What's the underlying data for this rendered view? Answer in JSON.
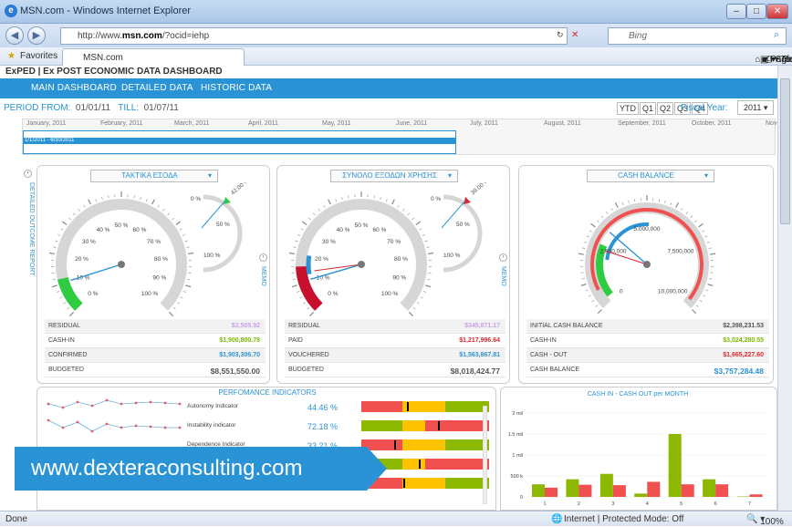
{
  "browser": {
    "window_title": "MSN.com - Windows Internet Explorer",
    "url_prefix": "http://www.",
    "url_domain": "msn.com",
    "url_suffix": "/?ocid=iehp",
    "search_placeholder": "Bing",
    "favorites_label": "Favorites",
    "tab_label": "MSN.com",
    "cmd_page": "Page ▾",
    "cmd_safety": "Safety ▾",
    "cmd_tools": "Tools ▾",
    "status_left": "Done",
    "status_zone": "Internet | Protected Mode: Off",
    "zoom": "100%"
  },
  "app": {
    "title": "ExPED | Ex POST ECONOMIC DATA DASHBOARD",
    "nav": [
      "MAIN DASHBOARD",
      "DETAILED DATA",
      "HISTORIC DATA"
    ],
    "period_label": "PERIOD FROM:",
    "period_from": "01/01/11",
    "period_till_label": "TILL:",
    "period_till": "01/07/11",
    "period_buttons": [
      "YTD",
      "Q1",
      "Q2",
      "Q3",
      "Q4"
    ],
    "fiscal_year_label": "Fiscal Year:",
    "fiscal_year": "2011",
    "timeline_months": [
      "January, 2011",
      "February, 2011",
      "March, 2011",
      "April, 2011",
      "May, 2011",
      "June, 2011",
      "July, 2011",
      "August, 2011",
      "September, 2011",
      "October, 2011",
      "Novemb"
    ],
    "timeline_selection": "1/1/2011 - 6/30/2011",
    "side_label": "DETAILED OUTCOME REPORT",
    "memo_label": "MEMO"
  },
  "gauges": [
    {
      "title": "ΤΑΚΤΙΚΑ ΕΣΟΔΑ",
      "main_ticks": [
        "0 %",
        "10 %",
        "20 %",
        "30 %",
        "40 %",
        "50 %",
        "60 %",
        "70 %",
        "80 %",
        "90 %",
        "100 %"
      ],
      "small_ticks": [
        "0 %",
        "50 %",
        "100 %"
      ],
      "small_value": "42.00 %",
      "rows": [
        {
          "k": "RESIDUAL",
          "v": "$2,505.92",
          "c": "#c9a0f0"
        },
        {
          "k": "CASH-IN",
          "v": "$1,900,800.78",
          "c": "#7ab800"
        },
        {
          "k": "CONFIRMED",
          "v": "$1,903,306.70",
          "c": "#2a93d5"
        },
        {
          "k": "BUDGETED",
          "v": "$8,551,550.00",
          "c": "#555"
        }
      ]
    },
    {
      "title": "ΣΥΝΟΛΟ ΕΞΟΔΩΝ ΧΡΗΣΗΣ",
      "main_ticks": [
        "0 %",
        "10 %",
        "20 %",
        "30 %",
        "40 %",
        "50 %",
        "60 %",
        "70 %",
        "80 %",
        "90 %",
        "100 %"
      ],
      "small_ticks": [
        "0 %",
        "50 %",
        "100 %"
      ],
      "small_value": "39.00 %",
      "rows": [
        {
          "k": "RESIDUAL",
          "v": "$345,871.17",
          "c": "#c9a0f0"
        },
        {
          "k": "PAID",
          "v": "$1,217,996.64",
          "c": "#d9262c"
        },
        {
          "k": "VOUCHERED",
          "v": "$1,563,867.81",
          "c": "#2a93d5"
        },
        {
          "k": "BUDGETED",
          "v": "$8,018,424.77",
          "c": "#555"
        }
      ]
    },
    {
      "title": "CASH BALANCE",
      "main_ticks": [
        "0",
        "2,500,000",
        "5,000,000",
        "7,500,000",
        "10,000,000"
      ],
      "rows": [
        {
          "k": "INITIAL CASH BALANCE",
          "v": "$2,398,231.53",
          "c": "#555"
        },
        {
          "k": "CASH-IN",
          "v": "$3,024,280.55",
          "c": "#7ab800"
        },
        {
          "k": "CASH - OUT",
          "v": "$1,665,227.60",
          "c": "#d9262c"
        },
        {
          "k": "CASH BALANCE",
          "v": "$3,757,284.48",
          "c": "#2a93d5"
        }
      ]
    }
  ],
  "performance": {
    "title": "PERFOMANCE INDICATORS",
    "rows": [
      {
        "name": "Autonomy Indicator",
        "pct": "44.46 %",
        "marker": 0.36
      },
      {
        "name": "Instability indicator",
        "pct": "72.18 %",
        "marker": 0.6
      },
      {
        "name": "Dependence Indicator",
        "pct": "33.21 %",
        "marker": 0.26
      },
      {
        "name": "",
        "pct": "",
        "marker": 0.45
      },
      {
        "name": "",
        "pct": "",
        "marker": 0.33
      }
    ]
  },
  "chart_data": {
    "type": "bar",
    "title": "CASH IN - CASH OUT per MONTH",
    "categories": [
      "1",
      "2",
      "3",
      "4",
      "5",
      "6",
      "7"
    ],
    "yticks": [
      "0",
      "500 k",
      "1 mil",
      "1.5 mil",
      "2 mil"
    ],
    "ylim": [
      0,
      2000000
    ],
    "series": [
      {
        "name": "",
        "color": "#8cb800",
        "values": [
          300000,
          420000,
          550000,
          80000,
          1500000,
          420000,
          10000
        ]
      },
      {
        "name": "",
        "color": "#f05050",
        "values": [
          220000,
          290000,
          280000,
          360000,
          300000,
          300000,
          60000
        ]
      }
    ]
  },
  "watermark": "www.dexteraconsulting.com"
}
